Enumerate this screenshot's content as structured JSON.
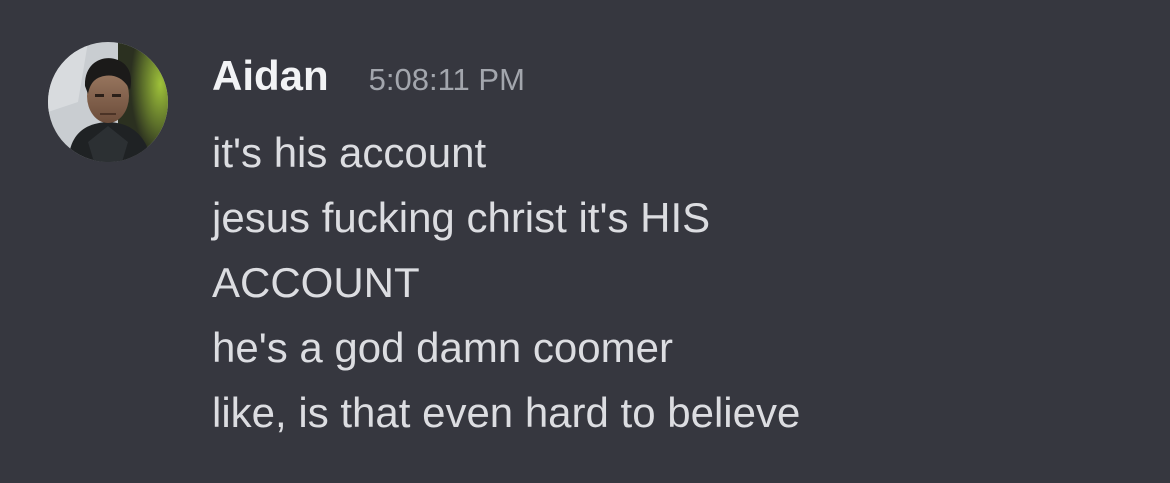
{
  "message": {
    "author": "Aidan",
    "timestamp": "5:08:11 PM",
    "avatar_icon": "user-avatar",
    "lines": [
      "it's his account",
      "jesus fucking christ it's HIS",
      "ACCOUNT",
      "he's a god damn coomer",
      "like, is that even hard to believe"
    ]
  },
  "colors": {
    "background": "#36373f",
    "author": "#f2f3f5",
    "timestamp": "#a3a6ad",
    "text": "#dcdde1"
  }
}
